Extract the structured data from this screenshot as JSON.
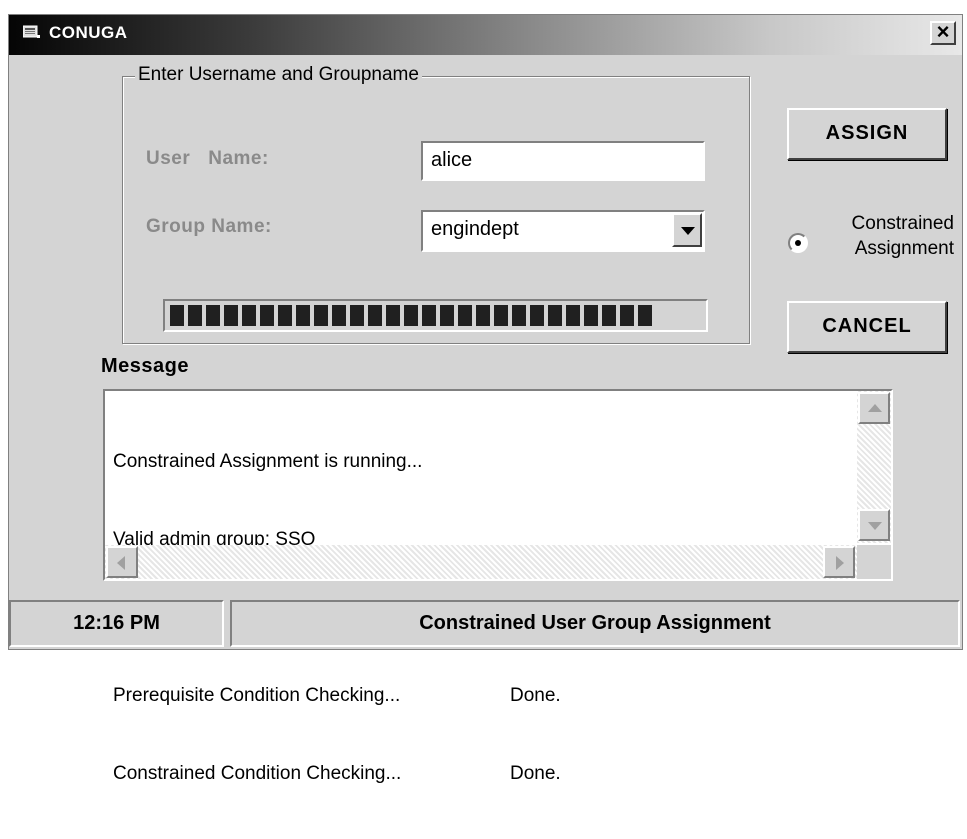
{
  "window": {
    "title": "CONUGA",
    "close_label": "×"
  },
  "form": {
    "group_legend": "Enter Username and Groupname",
    "user_label_part1": "User",
    "user_label_part2": "Name:",
    "group_label": "Group Name:",
    "user_value": "alice",
    "group_value": "engindept",
    "progress_blocks": 27
  },
  "buttons": {
    "assign": "ASSIGN",
    "cancel": "CANCEL"
  },
  "radio": {
    "line1": "Constrained",
    "line2": "Assignment",
    "selected": true
  },
  "message": {
    "heading": "Message",
    "lines": [
      {
        "text": "Constrained Assignment is running...",
        "status": ""
      },
      {
        "text": "Valid admin group: SSO",
        "status": ""
      },
      {
        "text": "",
        "status": ""
      },
      {
        "text": "Prerequisite Condition Checking...",
        "status": "Done."
      },
      {
        "text": "Constrained Condition Checking...",
        "status": "Done."
      }
    ]
  },
  "status": {
    "time": "12:16 PM",
    "text": "Constrained User Group Assignment"
  }
}
